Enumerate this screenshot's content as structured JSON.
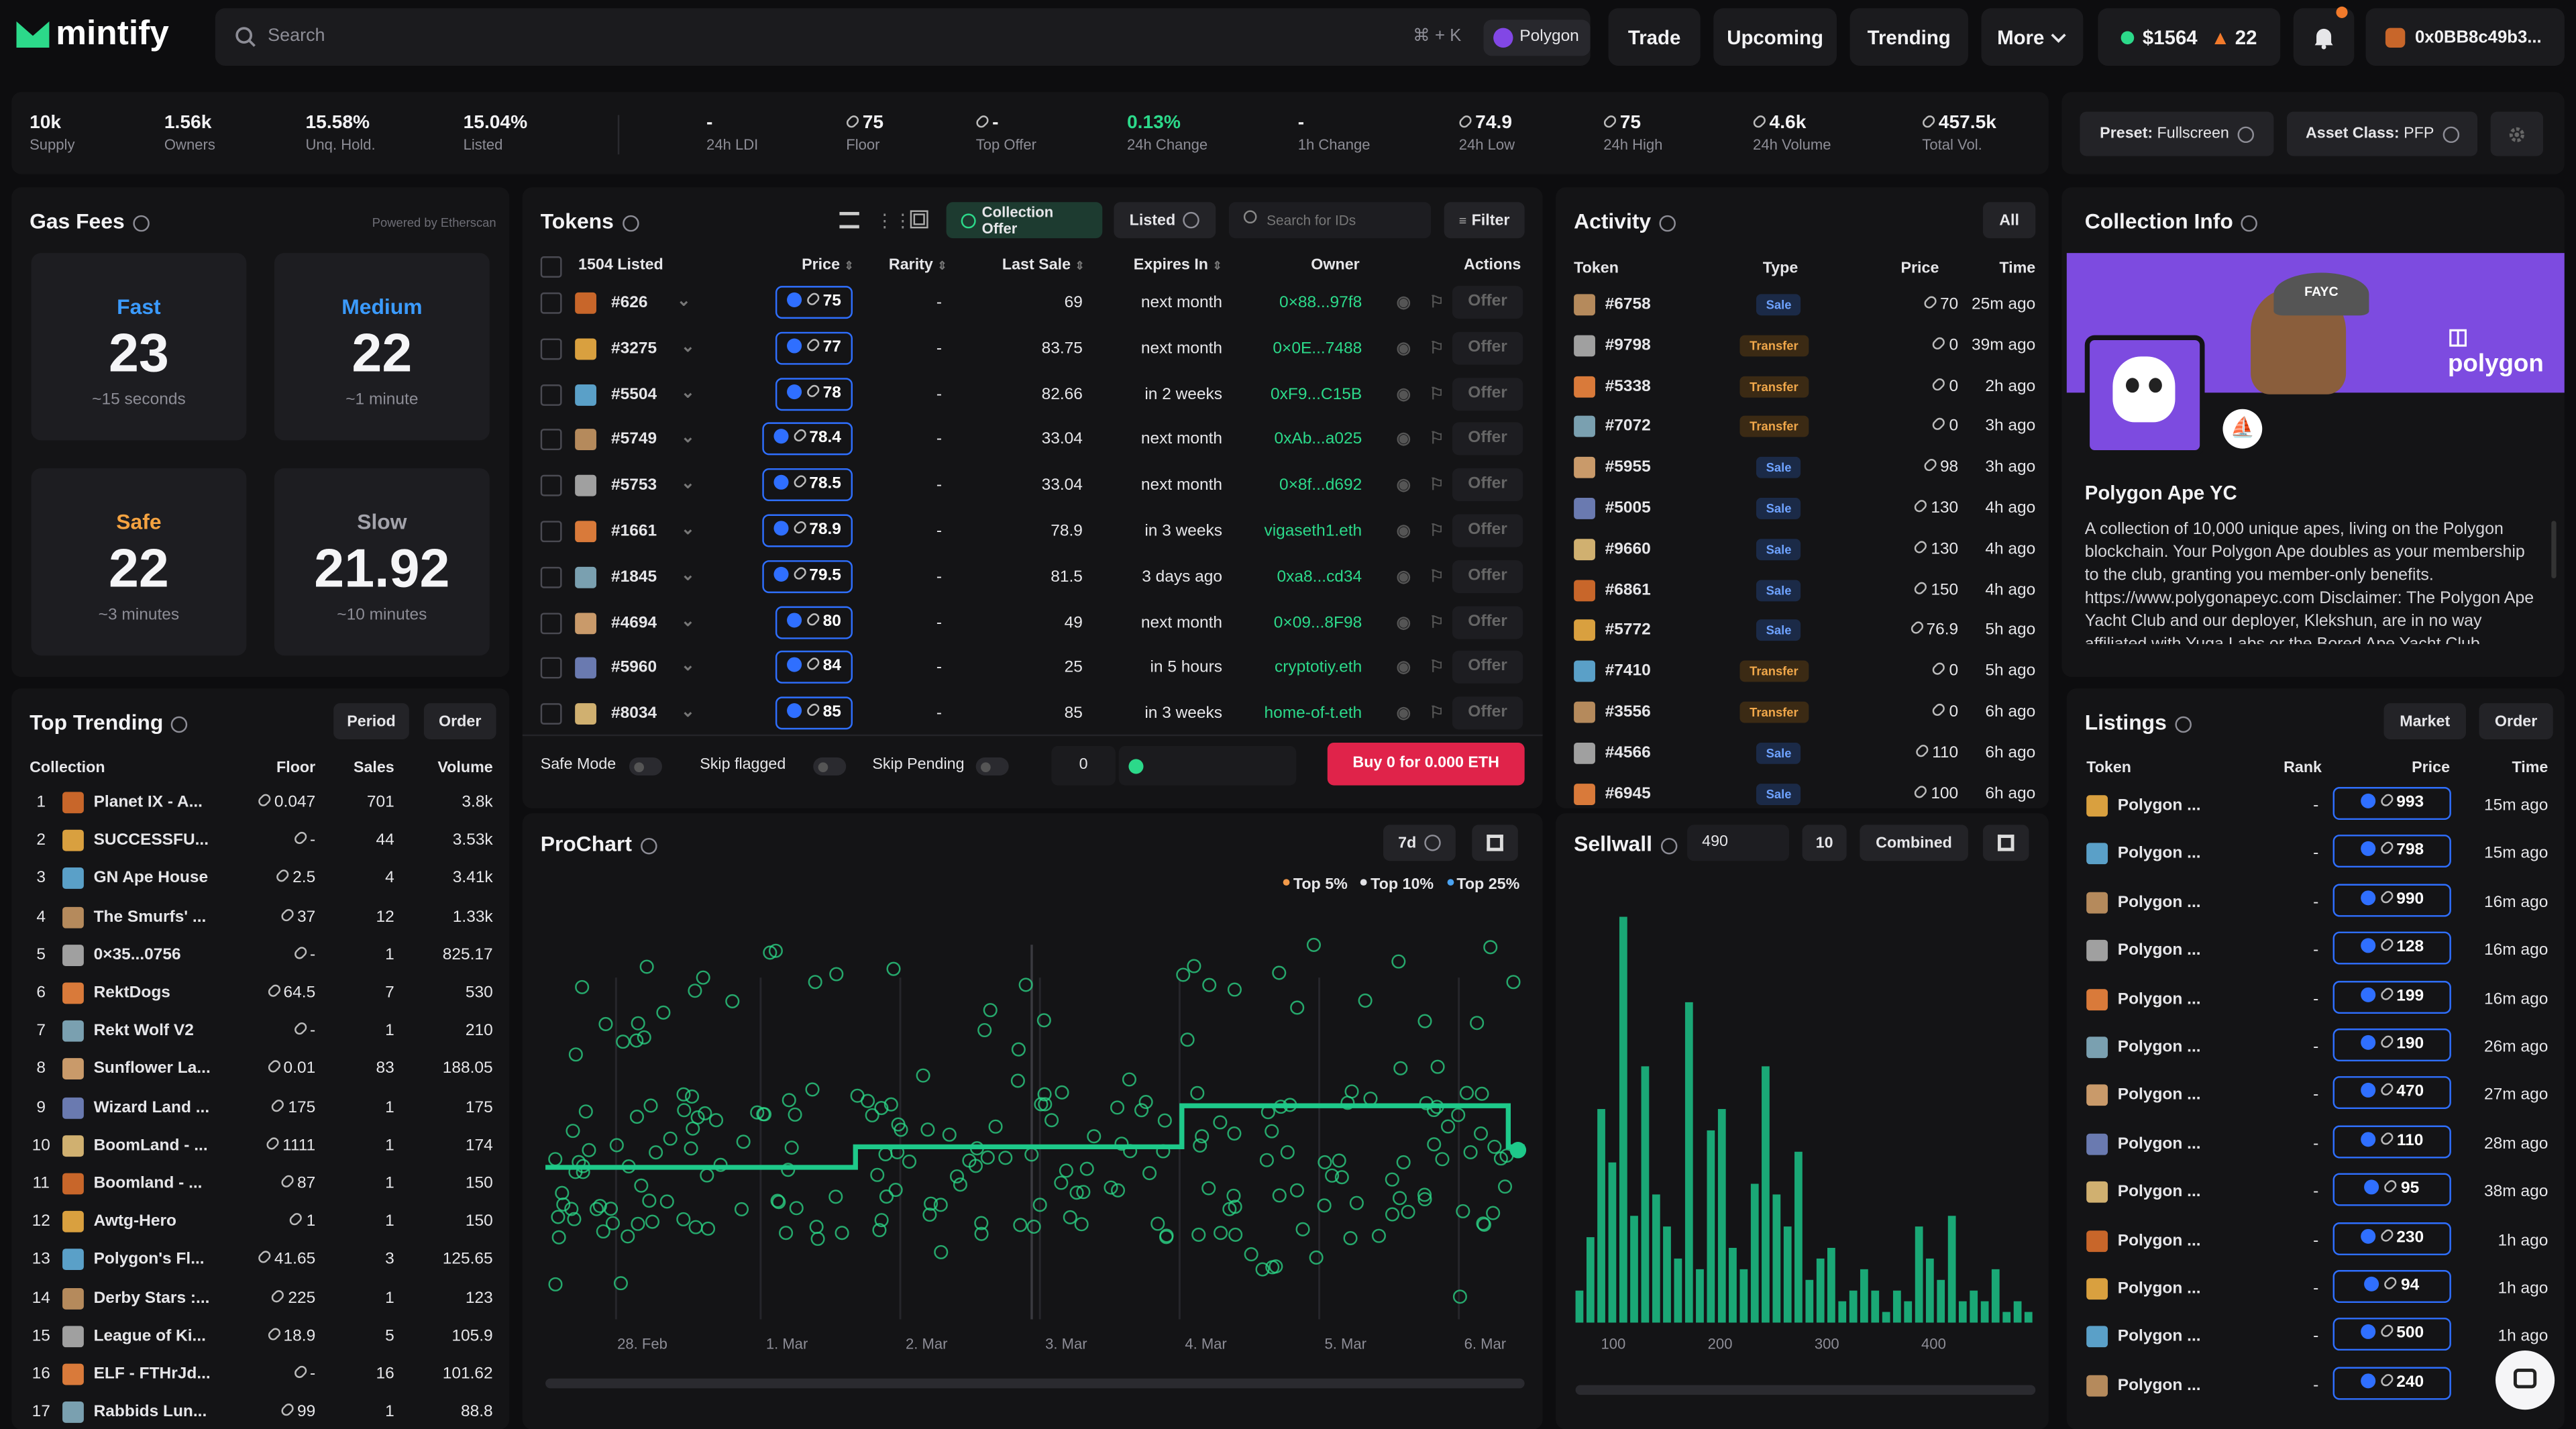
{
  "app": {
    "name": "mintify"
  },
  "header": {
    "search_placeholder": "Search",
    "shortcut": "⌘ + K",
    "chain": "Polygon",
    "nav": [
      "Trade",
      "Upcoming",
      "Trending",
      "More"
    ],
    "balance": "$1564",
    "streak": "22",
    "wallet": "0x0BB8c49b3..."
  },
  "stats": [
    {
      "value": "10k",
      "label": "Supply"
    },
    {
      "value": "1.56k",
      "label": "Owners"
    },
    {
      "value": "15.58%",
      "label": "Unq. Hold."
    },
    {
      "value": "15.04%",
      "label": "Listed"
    },
    {
      "value": "-",
      "label": "24h LDI"
    },
    {
      "value": "75",
      "label": "Floor"
    },
    {
      "value": "-",
      "label": "Top Offer"
    },
    {
      "value": "0.13%",
      "label": "24h Change"
    },
    {
      "value": "-",
      "label": "1h Change"
    },
    {
      "value": "74.9",
      "label": "24h Low"
    },
    {
      "value": "75",
      "label": "24h High"
    },
    {
      "value": "4.6k",
      "label": "24h Volume"
    },
    {
      "value": "457.5k",
      "label": "Total Vol."
    }
  ],
  "preset": {
    "label": "Preset:",
    "value": "Fullscreen"
  },
  "asset_class": {
    "label": "Asset Class:",
    "value": "PFP"
  },
  "gas": {
    "title": "Gas Fees",
    "powered": "Powered by Etherscan",
    "cards": [
      {
        "name": "Fast",
        "value": "23",
        "sub": "~15 seconds",
        "color": "#3b9bff"
      },
      {
        "name": "Medium",
        "value": "22",
        "sub": "~1 minute",
        "color": "#3b9bff"
      },
      {
        "name": "Safe",
        "value": "22",
        "sub": "~3 minutes",
        "color": "#f5a341"
      },
      {
        "name": "Slow",
        "value": "21.92",
        "sub": "~10 minutes",
        "color": "#a3a3ab"
      }
    ]
  },
  "trending": {
    "title": "Top Trending",
    "period_btn": "Period",
    "order_btn": "Order",
    "headers": [
      "Collection",
      "Floor",
      "Sales",
      "Volume"
    ],
    "rows": [
      {
        "rank": "1",
        "name": "Planet IX - A...",
        "floor": "0.047",
        "sales": "701",
        "volume": "3.8k"
      },
      {
        "rank": "2",
        "name": "SUCCESSFU...",
        "floor": "-",
        "sales": "44",
        "volume": "3.53k"
      },
      {
        "rank": "3",
        "name": "GN Ape House",
        "floor": "2.5",
        "sales": "4",
        "volume": "3.41k"
      },
      {
        "rank": "4",
        "name": "The Smurfs' ...",
        "floor": "37",
        "sales": "12",
        "volume": "1.33k"
      },
      {
        "rank": "5",
        "name": "0×35...0756",
        "floor": "-",
        "sales": "1",
        "volume": "825.17"
      },
      {
        "rank": "6",
        "name": "RektDogs",
        "floor": "64.5",
        "sales": "7",
        "volume": "530"
      },
      {
        "rank": "7",
        "name": "Rekt Wolf V2",
        "floor": "-",
        "sales": "1",
        "volume": "210"
      },
      {
        "rank": "8",
        "name": "Sunflower La...",
        "floor": "0.01",
        "sales": "83",
        "volume": "188.05"
      },
      {
        "rank": "9",
        "name": "Wizard Land ...",
        "floor": "175",
        "sales": "1",
        "volume": "175"
      },
      {
        "rank": "10",
        "name": "BoomLand - ...",
        "floor": "1111",
        "sales": "1",
        "volume": "174"
      },
      {
        "rank": "11",
        "name": "Boomland - ...",
        "floor": "87",
        "sales": "1",
        "volume": "150"
      },
      {
        "rank": "12",
        "name": "Awtg-Hero",
        "floor": "1",
        "sales": "1",
        "volume": "150"
      },
      {
        "rank": "13",
        "name": "Polygon's Fl...",
        "floor": "41.65",
        "sales": "3",
        "volume": "125.65"
      },
      {
        "rank": "14",
        "name": "Derby Stars :...",
        "floor": "225",
        "sales": "1",
        "volume": "123"
      },
      {
        "rank": "15",
        "name": "League of Ki...",
        "floor": "18.9",
        "sales": "5",
        "volume": "105.9"
      },
      {
        "rank": "16",
        "name": "ELF - FTHrJd...",
        "floor": "-",
        "sales": "16",
        "volume": "101.62"
      },
      {
        "rank": "17",
        "name": "Rabbids Lun...",
        "floor": "99",
        "sales": "1",
        "volume": "88.8"
      }
    ]
  },
  "tokens": {
    "title": "Tokens",
    "collection_offer": "Collection Offer",
    "listed_btn": "Listed",
    "search_placeholder": "Search for IDs",
    "filter": "Filter",
    "listed_count": "1504 Listed",
    "headers": [
      "Price",
      "Rarity",
      "Last Sale",
      "Expires In",
      "Owner",
      "Actions"
    ],
    "offer_label": "Offer",
    "rows": [
      {
        "id": "#626",
        "price": "75",
        "rarity": "-",
        "last": "69",
        "expires": "next month",
        "owner": "0×88...97f8"
      },
      {
        "id": "#3275",
        "price": "77",
        "rarity": "-",
        "last": "83.75",
        "expires": "next month",
        "owner": "0×0E...7488"
      },
      {
        "id": "#5504",
        "price": "78",
        "rarity": "-",
        "last": "82.66",
        "expires": "in 2 weeks",
        "owner": "0xF9...C15B"
      },
      {
        "id": "#5749",
        "price": "78.4",
        "rarity": "-",
        "last": "33.04",
        "expires": "next month",
        "owner": "0xAb...a025"
      },
      {
        "id": "#5753",
        "price": "78.5",
        "rarity": "-",
        "last": "33.04",
        "expires": "next month",
        "owner": "0×8f...d692"
      },
      {
        "id": "#1661",
        "price": "78.9",
        "rarity": "-",
        "last": "78.9",
        "expires": "in 3 weeks",
        "owner": "vigaseth1.eth"
      },
      {
        "id": "#1845",
        "price": "79.5",
        "rarity": "-",
        "last": "81.5",
        "expires": "3 days ago",
        "owner": "0xa8...cd34"
      },
      {
        "id": "#4694",
        "price": "80",
        "rarity": "-",
        "last": "49",
        "expires": "next month",
        "owner": "0×09...8F98"
      },
      {
        "id": "#5960",
        "price": "84",
        "rarity": "-",
        "last": "25",
        "expires": "in 5 hours",
        "owner": "cryptotiy.eth"
      },
      {
        "id": "#8034",
        "price": "85",
        "rarity": "-",
        "last": "85",
        "expires": "in 3 weeks",
        "owner": "home-of-t.eth"
      }
    ],
    "safe_mode": "Safe Mode",
    "skip_flagged": "Skip flagged",
    "skip_pending": "Skip Pending",
    "qty": "0",
    "buy_label": "Buy 0 for 0.000 ETH"
  },
  "activity": {
    "title": "Activity",
    "all_btn": "All",
    "headers": [
      "Token",
      "Type",
      "Price",
      "Time"
    ],
    "rows": [
      {
        "token": "#6758",
        "type": "Sale",
        "price": "70",
        "time": "25m ago"
      },
      {
        "token": "#9798",
        "type": "Transfer",
        "price": "0",
        "time": "39m ago"
      },
      {
        "token": "#5338",
        "type": "Transfer",
        "price": "0",
        "time": "2h ago"
      },
      {
        "token": "#7072",
        "type": "Transfer",
        "price": "0",
        "time": "3h ago"
      },
      {
        "token": "#5955",
        "type": "Sale",
        "price": "98",
        "time": "3h ago"
      },
      {
        "token": "#5005",
        "type": "Sale",
        "price": "130",
        "time": "4h ago"
      },
      {
        "token": "#9660",
        "type": "Sale",
        "price": "130",
        "time": "4h ago"
      },
      {
        "token": "#6861",
        "type": "Sale",
        "price": "150",
        "time": "4h ago"
      },
      {
        "token": "#5772",
        "type": "Sale",
        "price": "76.9",
        "time": "5h ago"
      },
      {
        "token": "#7410",
        "type": "Transfer",
        "price": "0",
        "time": "5h ago"
      },
      {
        "token": "#3556",
        "type": "Transfer",
        "price": "0",
        "time": "6h ago"
      },
      {
        "token": "#4566",
        "type": "Sale",
        "price": "110",
        "time": "6h ago"
      },
      {
        "token": "#6945",
        "type": "Sale",
        "price": "100",
        "time": "6h ago"
      }
    ]
  },
  "collection": {
    "title": "Collection Info",
    "banner_brand": "polygon",
    "cap_text": "FAYC",
    "name": "Polygon Ape YC",
    "description": "A collection of 10,000 unique apes, living on the Polygon blockchain. Your Polygon Ape doubles as your membership to the club, granting you member-only benefits. https://www.polygonapeyc.com Disclaimer: The Polygon Ape Yacht Club and our deployer, Klekshun, are in no way affiliated with Yuga Labs or the Bored Ape Yacht Club."
  },
  "listings": {
    "title": "Listings",
    "market_btn": "Market",
    "order_btn": "Order",
    "headers": [
      "Token",
      "Rank",
      "Price",
      "Time"
    ],
    "rows": [
      {
        "token": "Polygon ...",
        "rank": "-",
        "price": "993",
        "time": "15m ago"
      },
      {
        "token": "Polygon ...",
        "rank": "-",
        "price": "798",
        "time": "15m ago"
      },
      {
        "token": "Polygon ...",
        "rank": "-",
        "price": "990",
        "time": "16m ago"
      },
      {
        "token": "Polygon ...",
        "rank": "-",
        "price": "128",
        "time": "16m ago"
      },
      {
        "token": "Polygon ...",
        "rank": "-",
        "price": "199",
        "time": "16m ago"
      },
      {
        "token": "Polygon ...",
        "rank": "-",
        "price": "190",
        "time": "26m ago"
      },
      {
        "token": "Polygon ...",
        "rank": "-",
        "price": "470",
        "time": "27m ago"
      },
      {
        "token": "Polygon ...",
        "rank": "-",
        "price": "110",
        "time": "28m ago"
      },
      {
        "token": "Polygon ...",
        "rank": "-",
        "price": "95",
        "time": "38m ago"
      },
      {
        "token": "Polygon ...",
        "rank": "-",
        "price": "230",
        "time": "1h ago"
      },
      {
        "token": "Polygon ...",
        "rank": "-",
        "price": "94",
        "time": "1h ago"
      },
      {
        "token": "Polygon ...",
        "rank": "-",
        "price": "500",
        "time": "1h ago"
      },
      {
        "token": "Polygon ...",
        "rank": "-",
        "price": "240",
        "time": "1h ago"
      }
    ]
  },
  "prochart": {
    "title": "ProChart",
    "range": "7d",
    "legend": [
      {
        "name": "Top 5%",
        "color": "#f29a4a"
      },
      {
        "name": "Top 10%",
        "color": "#e2e2e6"
      },
      {
        "name": "Top 25%",
        "color": "#4aa3f2"
      }
    ],
    "xlabels": [
      "28. Feb",
      "1. Mar",
      "2. Mar",
      "3. Mar",
      "4. Mar",
      "5. Mar",
      "6. Mar"
    ]
  },
  "sellwall": {
    "title": "Sellwall",
    "input_value": "490",
    "bucket": "10",
    "mode": "Combined",
    "xlabels": [
      "100",
      "200",
      "300",
      "400"
    ]
  },
  "chart_data": [
    {
      "type": "scatter",
      "title": "ProChart",
      "x": [
        "28. Feb",
        "1. Mar",
        "2. Mar",
        "3. Mar",
        "4. Mar",
        "5. Mar",
        "6. Mar"
      ],
      "series": [
        {
          "name": "Floor",
          "values": [
            75,
            75,
            76,
            76,
            78,
            78,
            76
          ]
        }
      ]
    },
    {
      "type": "bar",
      "title": "Sellwall",
      "categories": [
        "80",
        "90",
        "100",
        "110",
        "120",
        "130",
        "140",
        "150",
        "160",
        "170",
        "180",
        "190",
        "200",
        "210",
        "220",
        "230",
        "240",
        "250",
        "260",
        "270",
        "280",
        "290",
        "300",
        "310",
        "320",
        "330",
        "340",
        "350",
        "360",
        "370",
        "380",
        "390",
        "400",
        "410",
        "420",
        "430",
        "440",
        "450",
        "460",
        "470",
        "480",
        "490"
      ],
      "values": [
        3,
        8,
        20,
        15,
        38,
        10,
        24,
        12,
        9,
        6,
        30,
        5,
        18,
        20,
        7,
        5,
        13,
        24,
        12,
        9,
        16,
        4,
        6,
        7,
        2,
        3,
        5,
        3,
        1,
        3,
        2,
        9,
        6,
        4,
        10,
        2,
        3,
        2,
        5,
        1,
        2,
        1
      ],
      "xlabel": "",
      "ylabel": ""
    }
  ]
}
